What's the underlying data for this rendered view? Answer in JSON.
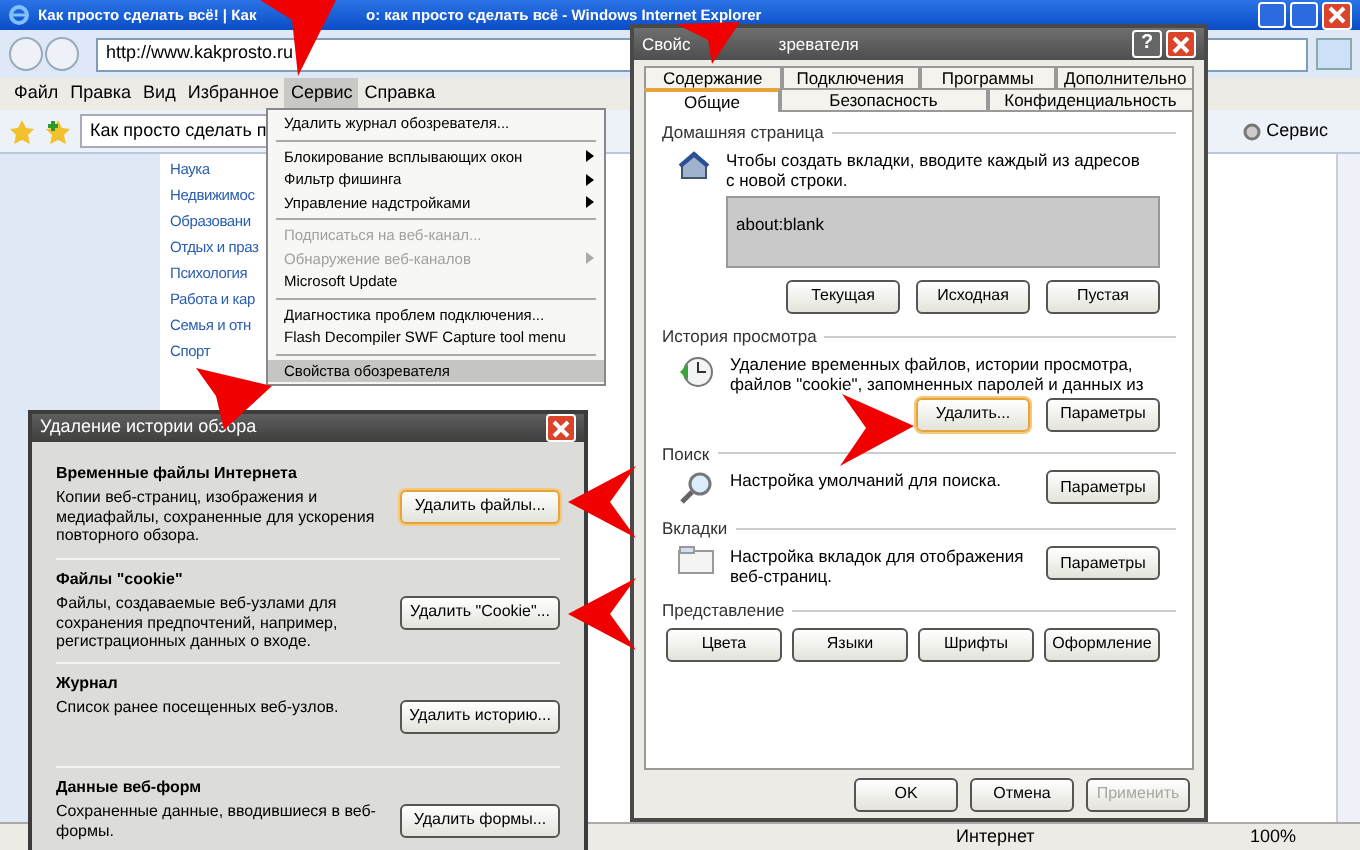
{
  "browser": {
    "title_parts": [
      "Как просто сделать всё! | Как",
      "о: как просто сделать всё - Windows Internet Explorer"
    ],
    "address": "http://www.kakprosto.ru",
    "menu": [
      {
        "label": "Файл",
        "selected": false
      },
      {
        "label": "Правка",
        "selected": false
      },
      {
        "label": "Вид",
        "selected": false
      },
      {
        "label": "Избранное",
        "selected": false
      },
      {
        "label": "Сервис",
        "selected": true
      },
      {
        "label": "Справка",
        "selected": false
      }
    ],
    "page_tab": "Как просто сделать п",
    "tools_button": "Сервис",
    "links": [
      "Наука",
      "Недвижимос",
      "Образовани",
      "Отдых и праз",
      "Психология",
      "Работа и кар",
      "Семья и отн",
      "Спорт"
    ],
    "status_zone": "Интернет",
    "zoom": "100%"
  },
  "tools_menu": [
    {
      "kind": "item",
      "label": "Удалить журнал обозревателя...",
      "submenu": false,
      "disabled": false,
      "selected": false
    },
    {
      "kind": "separator"
    },
    {
      "kind": "item",
      "label": "Блокирование всплывающих окон",
      "submenu": true,
      "disabled": false,
      "selected": false
    },
    {
      "kind": "item",
      "label": "Фильтр фишинга",
      "submenu": true,
      "disabled": false,
      "selected": false
    },
    {
      "kind": "item",
      "label": "Управление надстройками",
      "submenu": true,
      "disabled": false,
      "selected": false
    },
    {
      "kind": "separator"
    },
    {
      "kind": "item",
      "label": "Подписаться на веб-канал...",
      "submenu": false,
      "disabled": true,
      "selected": false
    },
    {
      "kind": "item",
      "label": "Обнаружение веб-каналов",
      "submenu": true,
      "disabled": true,
      "selected": false
    },
    {
      "kind": "item",
      "label": "Microsoft Update",
      "submenu": false,
      "disabled": false,
      "selected": false
    },
    {
      "kind": "separator"
    },
    {
      "kind": "item",
      "label": "Диагностика проблем подключения...",
      "submenu": false,
      "disabled": false,
      "selected": false
    },
    {
      "kind": "item",
      "label": "Flash Decompiler SWF Capture tool menu",
      "submenu": false,
      "disabled": false,
      "selected": false
    },
    {
      "kind": "separator"
    },
    {
      "kind": "item",
      "label": "Свойства обозревателя",
      "submenu": false,
      "disabled": false,
      "selected": true
    }
  ],
  "options_dialog": {
    "title_parts": [
      "Свойс",
      "зревателя"
    ],
    "help": "?",
    "tabs_back": [
      {
        "label": "Содержание",
        "selected": false
      },
      {
        "label": "Подключения",
        "selected": false
      },
      {
        "label": "Программы",
        "selected": false
      },
      {
        "label": "Дополнительно",
        "selected": false
      }
    ],
    "tabs_front": [
      {
        "label": "Общие",
        "selected": true
      },
      {
        "label": "Безопасность",
        "selected": false
      },
      {
        "label": "Конфиденциальность",
        "selected": false
      }
    ],
    "home_page": {
      "heading": "Домашняя страница",
      "text": "Чтобы создать вкладки, вводите каждый из адресов с новой строки.",
      "value": "about:blank",
      "buttons": [
        "Текущая",
        "Исходная",
        "Пустая"
      ]
    },
    "sections": [
      {
        "kind": "history",
        "heading": "История просмотра",
        "text": "Удаление временных файлов, истории просмотра, файлов \"cookie\", запомненных паролей и данных из",
        "buttons": [
          {
            "label": "Удалить...",
            "focused": true
          },
          {
            "label": "Параметры",
            "focused": false
          }
        ]
      },
      {
        "kind": "search",
        "heading": "Поиск",
        "text": "Настройка умолчаний для поиска.",
        "buttons": [
          {
            "label": "Параметры",
            "focused": false
          }
        ]
      },
      {
        "kind": "tabs",
        "heading": "Вкладки",
        "text": "Настройка вкладок для отображения веб-страниц.",
        "buttons": [
          {
            "label": "Параметры",
            "focused": false
          }
        ]
      }
    ],
    "appearance": {
      "heading": "Представление",
      "buttons": [
        "Цвета",
        "Языки",
        "Шрифты",
        "Оформление"
      ]
    },
    "footer": [
      {
        "label": "OK",
        "disabled": false
      },
      {
        "label": "Отмена",
        "disabled": false
      },
      {
        "label": "Применить",
        "disabled": true
      }
    ]
  },
  "delete_dialog": {
    "title": "Удаление истории обзора",
    "sections": [
      {
        "heading": "Временные файлы Интернета",
        "text": "Копии веб-страниц, изображения и медиафайлы, сохраненные для ускорения повторного обзора.",
        "button": "Удалить файлы...",
        "focused": true
      },
      {
        "heading": "Файлы \"cookie\"",
        "text": "Файлы, создаваемые веб-узлами для сохранения предпочтений, например, регистрационных данных о входе.",
        "button": "Удалить \"Cookie\"...",
        "focused": false
      },
      {
        "heading": "Журнал",
        "text": "Список ранее посещенных веб-узлов.",
        "button": "Удалить историю...",
        "focused": false
      },
      {
        "heading": "Данные веб-форм",
        "text": "Сохраненные данные, вводившиеся в веб-формы.",
        "button": "Удалить формы...",
        "focused": false
      }
    ]
  }
}
